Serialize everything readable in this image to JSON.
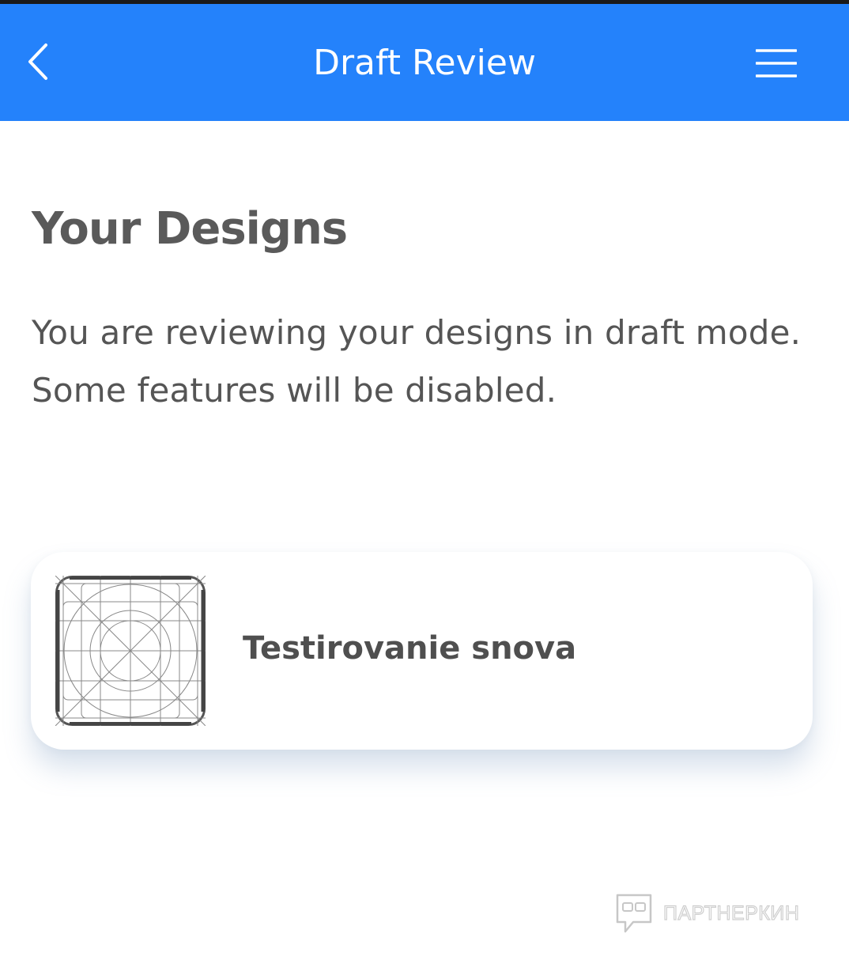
{
  "app_bar": {
    "title": "Draft Review",
    "background_color": "#2482fb",
    "back_icon": "chevron-left-icon",
    "menu_icon": "hamburger-menu-icon"
  },
  "main": {
    "heading": "Your Designs",
    "description": "You are reviewing your designs in draft mode. Some features will be disabled."
  },
  "designs": [
    {
      "title": "Testirovanie snova",
      "thumbnail_icon": "app-icon-grid-template-icon"
    }
  ],
  "watermark": {
    "text": "ПАРТНЕРКИН",
    "icon": "chat-bubble-logo-icon"
  }
}
